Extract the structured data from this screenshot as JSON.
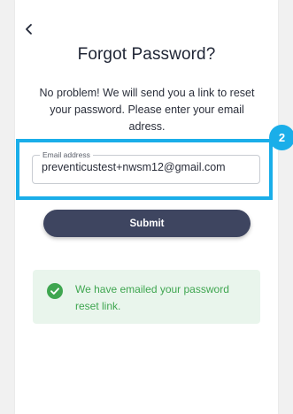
{
  "header": {
    "back_icon": "chevron-left-icon",
    "title": "Forgot Password?"
  },
  "description": "No problem! We will send you a link to reset your password. Please enter your email adress.",
  "step_badge": "2",
  "email_field": {
    "label": "Email address",
    "value": "preventicustest+nwsm12@gmail.com"
  },
  "submit_label": "Submit",
  "alert": {
    "icon": "check-circle-icon",
    "message": "We have emailed your password reset link."
  },
  "colors": {
    "primary_button": "#3e4560",
    "highlight": "#1aaee9",
    "success_bg": "#e9f5ec",
    "success_text": "#3fa650"
  }
}
